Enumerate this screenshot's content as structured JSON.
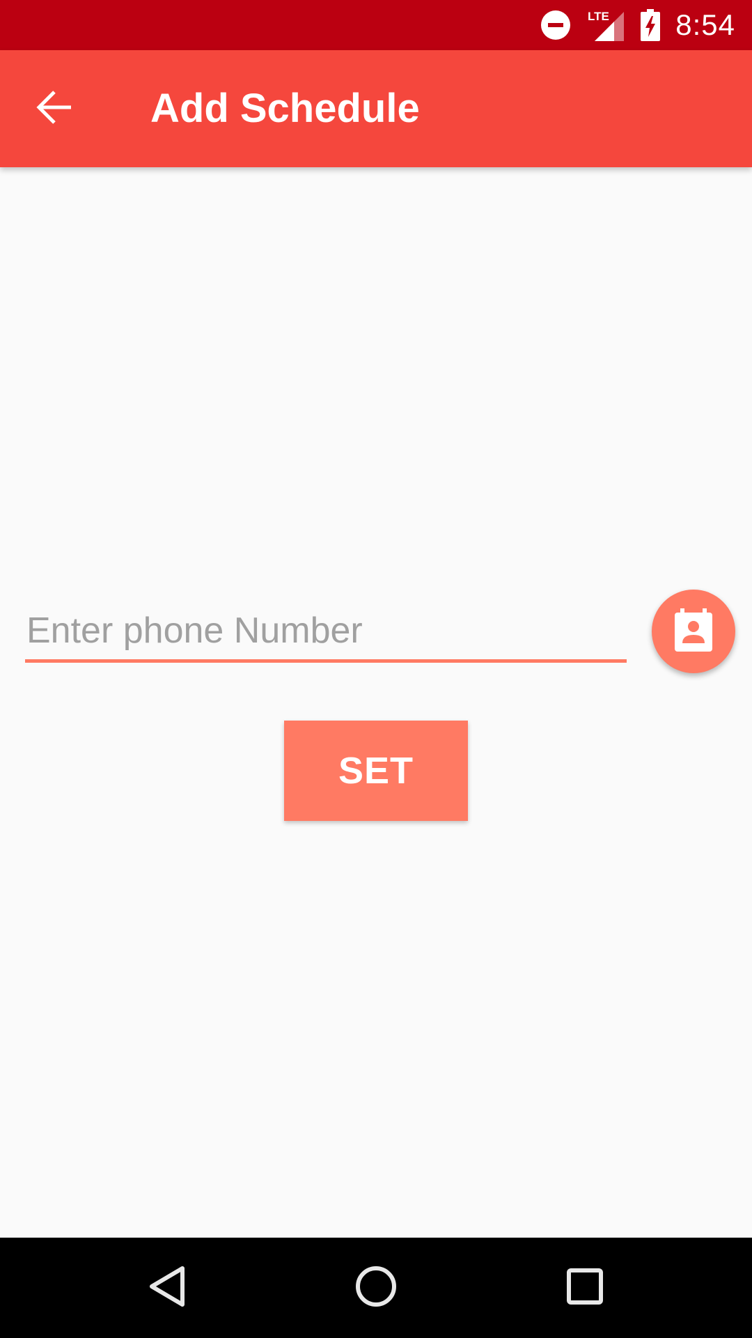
{
  "status_bar": {
    "time": "8:54",
    "network_label": "LTE",
    "icons": [
      "do-not-disturb-icon",
      "lte-signal-icon",
      "battery-charging-icon"
    ]
  },
  "app_bar": {
    "title": "Add Schedule",
    "back_icon": "arrow-back-icon"
  },
  "form": {
    "phone_placeholder": "Enter phone Number",
    "phone_value": "",
    "contacts_icon": "contact-card-icon",
    "set_label": "SET"
  },
  "nav_bar": {
    "icons": [
      "nav-back-icon",
      "nav-home-icon",
      "nav-recents-icon"
    ]
  },
  "colors": {
    "status_bar": "#bb0011",
    "app_bar": "#f5473d",
    "accent": "#ff7a63",
    "background": "#fafafa"
  }
}
